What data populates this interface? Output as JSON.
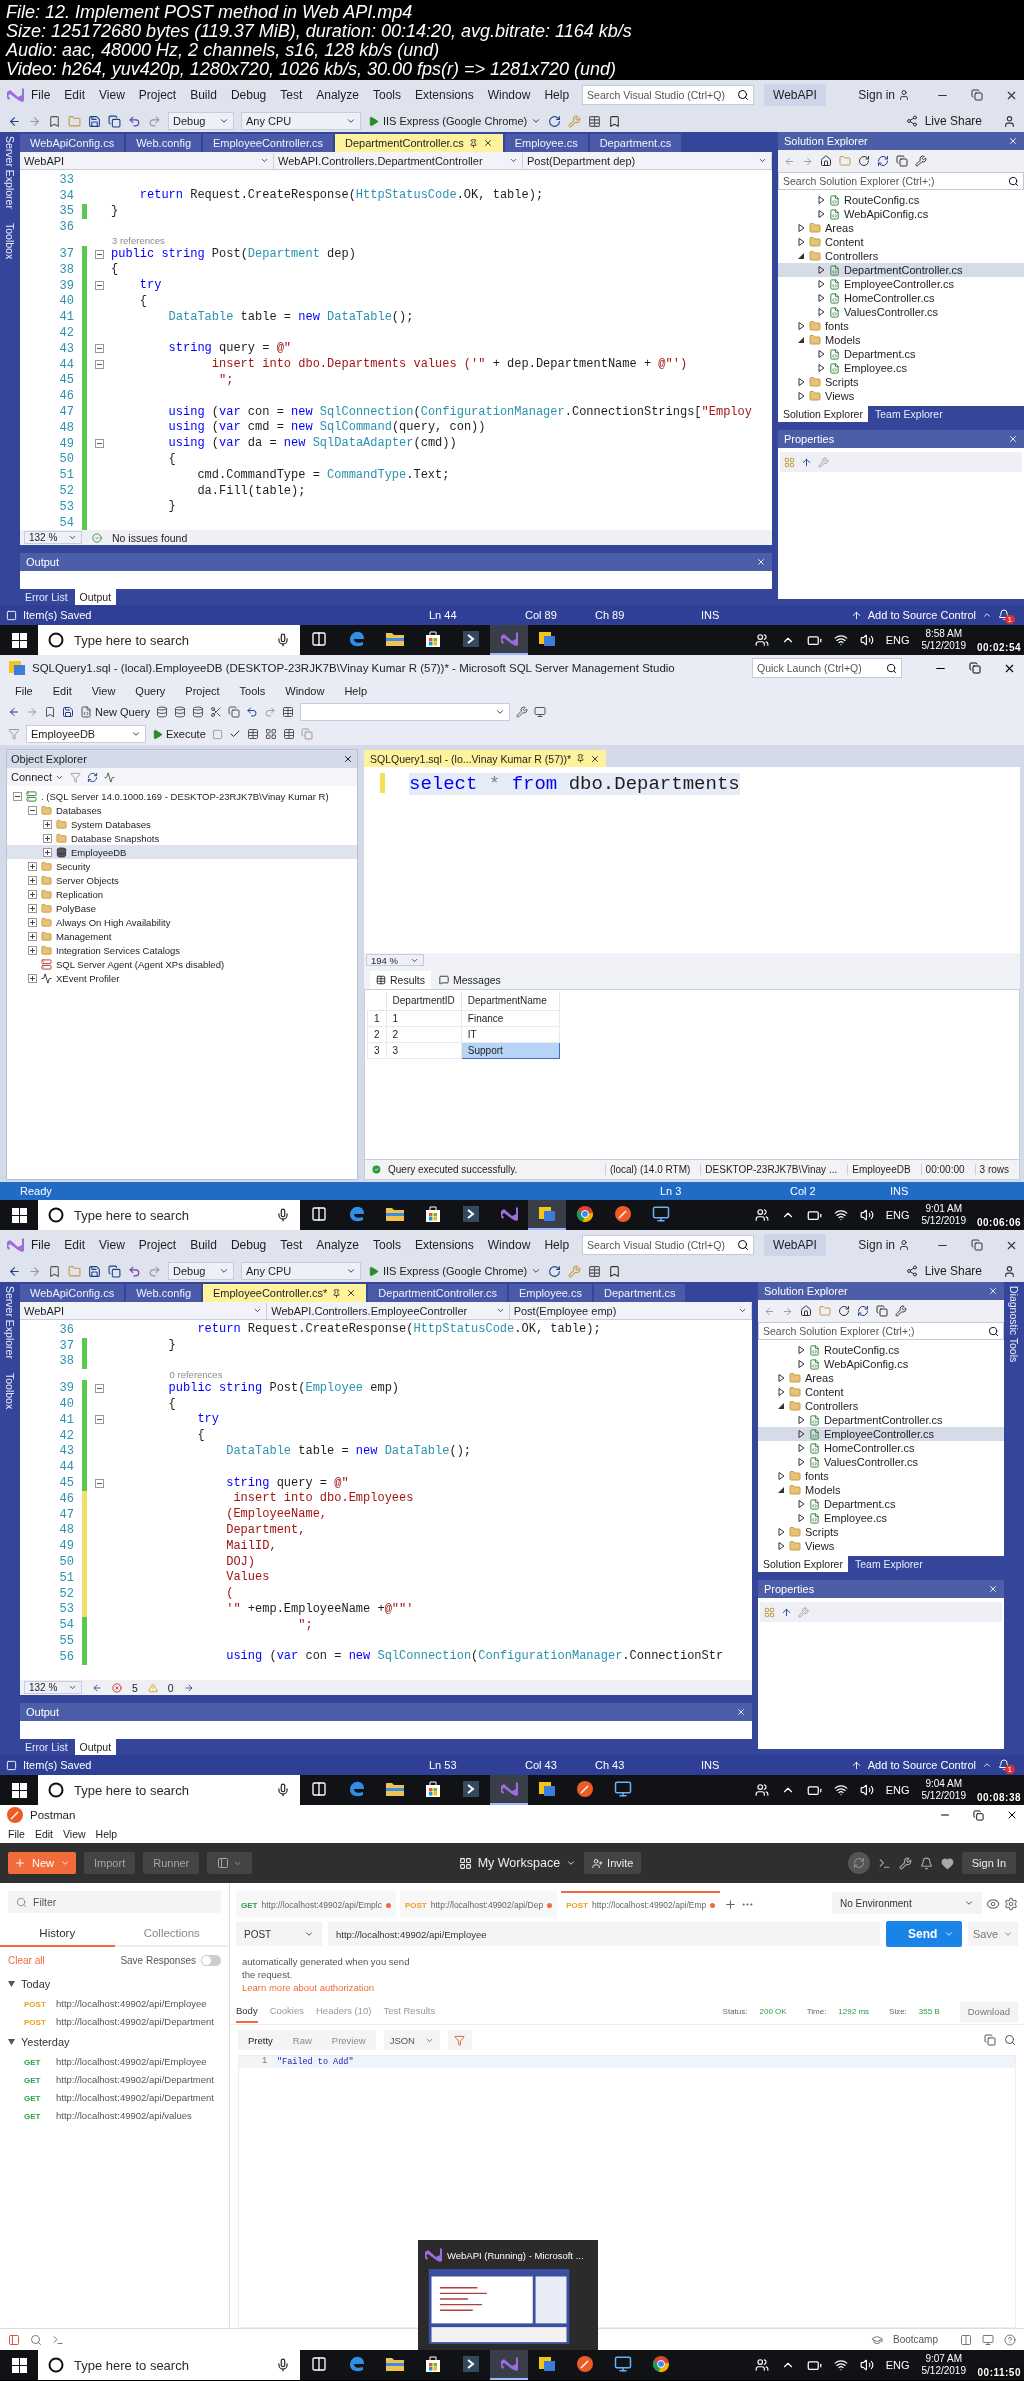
{
  "header": {
    "lines": [
      "File: 12. Implement POST method in Web API.mp4",
      "Size: 125172680 bytes (119.37 MiB), duration: 00:14:20, avg.bitrate: 1164 kb/s",
      "Audio: aac, 48000 Hz, 2 channels, s16, 128 kb/s (und)",
      "Video: h264, yuv420p, 1280x720, 1026 kb/s, 30.00 fps(r) => 1281x720 (und)"
    ]
  },
  "frames": [
    {
      "kind": "vs",
      "menu": [
        "File",
        "Edit",
        "View",
        "Project",
        "Build",
        "Debug",
        "Test",
        "Analyze",
        "Tools",
        "Extensions",
        "Window",
        "Help"
      ],
      "search": {
        "placeholder": "Search Visual Studio (Ctrl+Q)"
      },
      "solution_name": "WebAPI",
      "sign_in": "Sign in",
      "toolbar": {
        "configuration": "Debug",
        "platform": "Any CPU",
        "run": "IIS Express (Google Chrome)",
        "live_share": "Live Share"
      },
      "left_rail": [
        "Server Explorer",
        "Toolbox"
      ],
      "tabs": [
        {
          "label": "WebApiConfig.cs",
          "selected": false
        },
        {
          "label": "Web.config",
          "selected": false
        },
        {
          "label": "EmployeeController.cs",
          "selected": false
        },
        {
          "label": "DepartmentController.cs",
          "selected": true
        },
        {
          "label": "Employee.cs",
          "selected": false
        },
        {
          "label": "Department.cs",
          "selected": false
        }
      ],
      "nav": [
        "WebAPI",
        "WebAPI.Controllers.DepartmentController",
        "Post(Department dep)"
      ],
      "lines": [
        {
          "kind": "code",
          "n": "33"
        },
        {
          "kind": "code",
          "n": "34",
          "code": [
            {
              "kind": "kw",
              "text": "    return"
            },
            {
              "kind": "plain",
              "text": " Request.CreateResponse("
            },
            {
              "kind": "type",
              "text": "HttpStatusCode"
            },
            {
              "kind": "plain",
              "text": ".OK, table);"
            }
          ]
        },
        {
          "kind": "code",
          "n": "35",
          "color": "#5ac84e",
          "code": [
            {
              "kind": "plain",
              "text": "}"
            }
          ]
        },
        {
          "kind": "code",
          "n": "36"
        },
        {
          "kind": "lens",
          "text": "3 references"
        },
        {
          "kind": "code",
          "n": "37",
          "color": "#5ac84e",
          "fold": true,
          "code": [
            {
              "kind": "kw",
              "text": "public string"
            },
            {
              "kind": "plain",
              "text": " Post("
            },
            {
              "kind": "type",
              "text": "Department"
            },
            {
              "kind": "plain",
              "text": " dep)"
            }
          ]
        },
        {
          "kind": "code",
          "n": "38",
          "color": "#5ac84e",
          "code": [
            {
              "kind": "plain",
              "text": "{"
            }
          ]
        },
        {
          "kind": "code",
          "n": "39",
          "color": "#5ac84e",
          "fold": true,
          "code": [
            {
              "kind": "kw",
              "text": "    try"
            }
          ]
        },
        {
          "kind": "code",
          "n": "40",
          "color": "#5ac84e",
          "code": [
            {
              "kind": "plain",
              "text": "    {"
            }
          ]
        },
        {
          "kind": "code",
          "n": "41",
          "color": "#5ac84e",
          "code": [
            {
              "kind": "type",
              "text": "        DataTable"
            },
            {
              "kind": "plain",
              "text": " table = "
            },
            {
              "kind": "kw",
              "text": "new"
            },
            {
              "kind": "type",
              "text": " DataTable"
            },
            {
              "kind": "plain",
              "text": "();"
            }
          ]
        },
        {
          "kind": "code",
          "n": "42",
          "color": "#5ac84e"
        },
        {
          "kind": "code",
          "n": "43",
          "color": "#5ac84e",
          "fold": true,
          "code": [
            {
              "kind": "kw",
              "text": "        string"
            },
            {
              "kind": "plain",
              "text": " query = "
            },
            {
              "kind": "str",
              "text": "@\""
            }
          ]
        },
        {
          "kind": "code",
          "n": "44",
          "color": "#5ac84e",
          "fold": true,
          "code": [
            {
              "kind": "str",
              "text": "              insert into dbo.Departments values ('\""
            },
            {
              "kind": "plain",
              "text": " + dep.DepartmentName + "
            },
            {
              "kind": "str",
              "text": "@\"')"
            }
          ]
        },
        {
          "kind": "code",
          "n": "45",
          "color": "#5ac84e",
          "code": [
            {
              "kind": "str",
              "text": "               \";"
            }
          ]
        },
        {
          "kind": "code",
          "n": "46",
          "color": "#5ac84e"
        },
        {
          "kind": "code",
          "n": "47",
          "color": "#5ac84e",
          "code": [
            {
              "kind": "kw",
              "text": "        using"
            },
            {
              "kind": "plain",
              "text": " ("
            },
            {
              "kind": "kw",
              "text": "var"
            },
            {
              "kind": "plain",
              "text": " con = "
            },
            {
              "kind": "kw",
              "text": "new"
            },
            {
              "kind": "type",
              "text": " SqlConnection"
            },
            {
              "kind": "plain",
              "text": "("
            },
            {
              "kind": "type",
              "text": "ConfigurationManager"
            },
            {
              "kind": "plain",
              "text": ".ConnectionStrings["
            },
            {
              "kind": "str",
              "text": "\"Employ"
            }
          ]
        },
        {
          "kind": "code",
          "n": "48",
          "color": "#5ac84e",
          "code": [
            {
              "kind": "kw",
              "text": "        using"
            },
            {
              "kind": "plain",
              "text": " ("
            },
            {
              "kind": "kw",
              "text": "var"
            },
            {
              "kind": "plain",
              "text": " cmd = "
            },
            {
              "kind": "kw",
              "text": "new"
            },
            {
              "kind": "type",
              "text": " SqlCommand"
            },
            {
              "kind": "plain",
              "text": "(query, con))"
            }
          ]
        },
        {
          "kind": "code",
          "n": "49",
          "color": "#5ac84e",
          "fold": true,
          "code": [
            {
              "kind": "kw",
              "text": "        using"
            },
            {
              "kind": "plain",
              "text": " ("
            },
            {
              "kind": "kw",
              "text": "var"
            },
            {
              "kind": "plain",
              "text": " da = "
            },
            {
              "kind": "kw",
              "text": "new"
            },
            {
              "kind": "type",
              "text": " SqlDataAdapter"
            },
            {
              "kind": "plain",
              "text": "(cmd))"
            }
          ]
        },
        {
          "kind": "code",
          "n": "50",
          "color": "#5ac84e",
          "code": [
            {
              "kind": "plain",
              "text": "        {"
            }
          ]
        },
        {
          "kind": "code",
          "n": "51",
          "color": "#5ac84e",
          "code": [
            {
              "kind": "plain",
              "text": "            cmd.CommandType = "
            },
            {
              "kind": "type",
              "text": "CommandType"
            },
            {
              "kind": "plain",
              "text": ".Text;"
            }
          ]
        },
        {
          "kind": "code",
          "n": "52",
          "color": "#5ac84e",
          "code": [
            {
              "kind": "plain",
              "text": "            da.Fill(table);"
            }
          ]
        },
        {
          "kind": "code",
          "n": "53",
          "color": "#5ac84e",
          "code": [
            {
              "kind": "plain",
              "text": "        }"
            }
          ]
        },
        {
          "kind": "code",
          "n": "54",
          "color": "#5ac84e"
        }
      ],
      "editor_status": {
        "zoom": "132 %",
        "issues": "No issues found"
      },
      "output": {
        "title": "Output",
        "tabs": [
          {
            "label": "Error List",
            "selected": false
          },
          {
            "label": "Output",
            "selected": true
          }
        ]
      },
      "solution_explorer": {
        "title": "Solution Explorer",
        "search": {
          "placeholder": "Search Solution Explorer (Ctrl+;)"
        },
        "tree": [
          {
            "children": [
              {
                "label": "RouteConfig.cs",
                "kind": "file",
                "expanded": false,
                "selected": false
              },
              {
                "label": "WebApiConfig.cs",
                "kind": "file",
                "expanded": false,
                "selected": false
              }
            ]
          },
          {
            "label": "Areas",
            "kind": "folder",
            "expanded": false,
            "selected": false
          },
          {
            "label": "Content",
            "kind": "folder",
            "expanded": false,
            "selected": false
          },
          {
            "label": "Controllers",
            "kind": "folder",
            "expanded": true,
            "selected": false,
            "children": [
              {
                "label": "DepartmentController.cs",
                "kind": "file",
                "expanded": false,
                "selected": true
              },
              {
                "label": "EmployeeController.cs",
                "kind": "file",
                "expanded": false,
                "selected": false
              },
              {
                "label": "HomeController.cs",
                "kind": "file",
                "expanded": false,
                "selected": false
              },
              {
                "label": "ValuesController.cs",
                "kind": "file",
                "expanded": false,
                "selected": false
              }
            ]
          },
          {
            "label": "fonts",
            "kind": "folder",
            "expanded": false,
            "selected": false
          },
          {
            "label": "Models",
            "kind": "folder",
            "expanded": true,
            "selected": false,
            "children": [
              {
                "label": "Department.cs",
                "kind": "file",
                "expanded": false,
                "selected": false
              },
              {
                "label": "Employee.cs",
                "kind": "file",
                "expanded": false,
                "selected": false
              }
            ]
          },
          {
            "label": "Scripts",
            "kind": "folder",
            "expanded": false,
            "selected": false
          },
          {
            "label": "Views",
            "kind": "folder",
            "expanded": false,
            "selected": false
          }
        ],
        "tabs": [
          {
            "label": "Solution Explorer",
            "selected": true
          },
          {
            "label": "Team Explorer",
            "selected": false
          }
        ]
      },
      "properties": {
        "title": "Properties"
      },
      "status_bar": {
        "message": "Item(s) Saved",
        "ln": "Ln 44",
        "col": "Col 89",
        "ch": "Ch 89",
        "mode": "INS",
        "source_control": "Add to Source Control",
        "notifications": "1"
      },
      "taskbar": {
        "search": {
          "placeholder": "Type here to search"
        },
        "apps": [
          {
            "kind": "edge",
            "active": false
          },
          {
            "kind": "explorer",
            "active": false
          },
          {
            "kind": "store",
            "active": false
          },
          {
            "kind": "terminal",
            "active": false
          },
          {
            "kind": "vs",
            "active": true
          },
          {
            "kind": "ssms",
            "active": false
          }
        ],
        "language": "ENG",
        "time": "8:58 AM",
        "date": "5/12/2019"
      },
      "timestamp": "00:02:54"
    },
    {
      "kind": "ssms",
      "title": "SQLQuery1.sql - (local).EmployeeDB (DESKTOP-23RJK7B\\Vinay Kumar R (57))* - Microsoft SQL Server Management Studio",
      "quick_launch": {
        "placeholder": "Quick Launch (Ctrl+Q)"
      },
      "menu": [
        "File",
        "Edit",
        "View",
        "Query",
        "Project",
        "Tools",
        "Window",
        "Help"
      ],
      "toolbar": {
        "new_query": "New Query",
        "database": "EmployeeDB",
        "execute": "Execute"
      },
      "object_explorer": {
        "title": "Object Explorer",
        "connect": "Connect",
        "tree": [
          {
            "label": ". (SQL Server 14.0.1000.169 - DESKTOP-23RJK7B\\Vinay Kumar R)",
            "kind": "server",
            "expanded": true,
            "selected": false,
            "children": [
              {
                "label": "Databases",
                "kind": "folder",
                "expanded": true,
                "selected": false,
                "children": [
                  {
                    "label": "System Databases",
                    "kind": "folder",
                    "expanded": false,
                    "selected": false
                  },
                  {
                    "label": "Database Snapshots",
                    "kind": "folder",
                    "expanded": false,
                    "selected": false
                  },
                  {
                    "label": "EmployeeDB",
                    "kind": "database",
                    "expanded": false,
                    "selected": true
                  }
                ]
              },
              {
                "label": "Security",
                "kind": "folder",
                "expanded": false,
                "selected": false
              },
              {
                "label": "Server Objects",
                "kind": "folder",
                "expanded": false,
                "selected": false
              },
              {
                "label": "Replication",
                "kind": "folder",
                "expanded": false,
                "selected": false
              },
              {
                "label": "PolyBase",
                "kind": "folder",
                "expanded": false,
                "selected": false
              },
              {
                "label": "Always On High Availability",
                "kind": "folder",
                "expanded": false,
                "selected": false
              },
              {
                "label": "Management",
                "kind": "folder",
                "expanded": false,
                "selected": false
              },
              {
                "label": "Integration Services Catalogs",
                "kind": "folder",
                "expanded": false,
                "selected": false
              },
              {
                "label": "SQL Server Agent (Agent XPs disabled)",
                "kind": "agent",
                "selected": false
              },
              {
                "label": "XEvent Profiler",
                "kind": "xevent",
                "expanded": false,
                "selected": false
              }
            ]
          }
        ]
      },
      "query_tab": "SQLQuery1.sql - (lo...Vinay Kumar R (57))*",
      "query": [
        {
          "kind": "kw",
          "text": "select"
        },
        {
          "kind": "op",
          "text": " * "
        },
        {
          "kind": "kw",
          "text": "from"
        },
        {
          "kind": "plain",
          "text": " dbo.Departments"
        }
      ],
      "zoom": "194 %",
      "result_tabs": [
        {
          "label": "Results",
          "selected": true
        },
        {
          "label": "Messages",
          "selected": false
        }
      ],
      "grid": {
        "columns": [
          "DepartmentID",
          "DepartmentName"
        ],
        "rows": [
          {
            "n": "1",
            "cells": [
              {
                "text": "1",
                "selected": false
              },
              {
                "text": "Finance",
                "selected": false
              }
            ]
          },
          {
            "n": "2",
            "cells": [
              {
                "text": "2",
                "selected": false
              },
              {
                "text": "IT",
                "selected": false
              }
            ]
          },
          {
            "n": "3",
            "cells": [
              {
                "text": "3",
                "selected": false
              },
              {
                "text": "Support",
                "selected": true
              }
            ]
          }
        ]
      },
      "query_status": {
        "message": "Query executed successfully.",
        "server": "(local) (14.0 RTM)",
        "user": "DESKTOP-23RJK7B\\Vinay ...",
        "database": "EmployeeDB",
        "elapsed": "00:00:00",
        "rows": "3 rows"
      },
      "status_bar": {
        "message": "Ready",
        "ln": "Ln 3",
        "col": "Col 2",
        "mode": "INS"
      },
      "taskbar": {
        "search": {
          "placeholder": "Type here to search"
        },
        "apps": [
          {
            "kind": "edge",
            "active": false
          },
          {
            "kind": "explorer",
            "active": false
          },
          {
            "kind": "store",
            "active": false
          },
          {
            "kind": "terminal",
            "active": false
          },
          {
            "kind": "vs",
            "active": false
          },
          {
            "kind": "ssms",
            "active": true
          },
          {
            "kind": "chrome",
            "active": false
          },
          {
            "kind": "postman",
            "active": false
          },
          {
            "kind": "rdp",
            "active": false
          }
        ],
        "language": "ENG",
        "time": "9:01 AM",
        "date": "5/12/2019"
      },
      "timestamp": "00:06:06"
    },
    {
      "kind": "vs",
      "menu": [
        "File",
        "Edit",
        "View",
        "Project",
        "Build",
        "Debug",
        "Test",
        "Analyze",
        "Tools",
        "Extensions",
        "Window",
        "Help"
      ],
      "search": {
        "placeholder": "Search Visual Studio (Ctrl+Q)"
      },
      "solution_name": "WebAPI",
      "sign_in": "Sign in",
      "toolbar": {
        "configuration": "Debug",
        "platform": "Any CPU",
        "run": "IIS Express (Google Chrome)",
        "live_share": "Live Share"
      },
      "left_rail": [
        "Server Explorer",
        "Toolbox"
      ],
      "right_rail": [
        "Diagnostic Tools"
      ],
      "tabs": [
        {
          "label": "WebApiConfig.cs",
          "selected": false
        },
        {
          "label": "Web.config",
          "selected": false
        },
        {
          "label": "EmployeeController.cs*",
          "selected": true
        },
        {
          "label": "DepartmentController.cs",
          "selected": false
        },
        {
          "label": "Employee.cs",
          "selected": false
        },
        {
          "label": "Department.cs",
          "selected": false
        }
      ],
      "nav": [
        "WebAPI",
        "WebAPI.Controllers.EmployeeController",
        "Post(Employee emp)"
      ],
      "lines": [
        {
          "kind": "code",
          "n": "36",
          "code": [
            {
              "kind": "kw",
              "text": "            return"
            },
            {
              "kind": "plain",
              "text": " Request.CreateResponse("
            },
            {
              "kind": "type",
              "text": "HttpStatusCode"
            },
            {
              "kind": "plain",
              "text": ".OK, table);"
            }
          ]
        },
        {
          "kind": "code",
          "n": "37",
          "color": "#5ac84e",
          "code": [
            {
              "kind": "plain",
              "text": "        }"
            }
          ]
        },
        {
          "kind": "code",
          "n": "38",
          "color": "#5ac84e"
        },
        {
          "kind": "lens",
          "text": "0 references"
        },
        {
          "kind": "code",
          "n": "39",
          "color": "#5ac84e",
          "fold": true,
          "code": [
            {
              "kind": "kw",
              "text": "        public string"
            },
            {
              "kind": "plain",
              "text": " Post("
            },
            {
              "kind": "type",
              "text": "Employee"
            },
            {
              "kind": "plain",
              "text": " emp)"
            }
          ]
        },
        {
          "kind": "code",
          "n": "40",
          "color": "#5ac84e",
          "code": [
            {
              "kind": "plain",
              "text": "        {"
            }
          ]
        },
        {
          "kind": "code",
          "n": "41",
          "color": "#5ac84e",
          "fold": true,
          "code": [
            {
              "kind": "kw",
              "text": "            try"
            }
          ]
        },
        {
          "kind": "code",
          "n": "42",
          "color": "#5ac84e",
          "code": [
            {
              "kind": "plain",
              "text": "            {"
            }
          ]
        },
        {
          "kind": "code",
          "n": "43",
          "color": "#5ac84e",
          "code": [
            {
              "kind": "type",
              "text": "                DataTable"
            },
            {
              "kind": "plain",
              "text": " table = "
            },
            {
              "kind": "kw",
              "text": "new"
            },
            {
              "kind": "type",
              "text": " DataTable"
            },
            {
              "kind": "plain",
              "text": "();"
            }
          ]
        },
        {
          "kind": "code",
          "n": "44",
          "color": "#5ac84e"
        },
        {
          "kind": "code",
          "n": "45",
          "color": "#5ac84e",
          "fold": true,
          "code": [
            {
              "kind": "kw",
              "text": "                string"
            },
            {
              "kind": "plain",
              "text": " query = "
            },
            {
              "kind": "str",
              "text": "@\""
            }
          ]
        },
        {
          "kind": "code",
          "n": "46",
          "color": "#eedf6a",
          "code": [
            {
              "kind": "str",
              "text": "                 insert into dbo.Employees"
            }
          ]
        },
        {
          "kind": "code",
          "n": "47",
          "color": "#eedf6a",
          "code": [
            {
              "kind": "str",
              "text": "                (EmployeeName,"
            }
          ]
        },
        {
          "kind": "code",
          "n": "48",
          "color": "#eedf6a",
          "code": [
            {
              "kind": "str",
              "text": "                Department,"
            }
          ]
        },
        {
          "kind": "code",
          "n": "49",
          "color": "#eedf6a",
          "code": [
            {
              "kind": "str",
              "text": "                MailID,"
            }
          ]
        },
        {
          "kind": "code",
          "n": "50",
          "color": "#eedf6a",
          "code": [
            {
              "kind": "str",
              "text": "                DOJ)"
            }
          ]
        },
        {
          "kind": "code",
          "n": "51",
          "color": "#eedf6a",
          "code": [
            {
              "kind": "str",
              "text": "                Values"
            }
          ]
        },
        {
          "kind": "code",
          "n": "52",
          "color": "#eedf6a",
          "code": [
            {
              "kind": "str",
              "text": "                ("
            }
          ]
        },
        {
          "kind": "code",
          "n": "53",
          "color": "#eedf6a",
          "code": [
            {
              "kind": "str",
              "text": "                '\""
            },
            {
              "kind": "plain",
              "text": " +emp.EmployeeName +"
            },
            {
              "kind": "str",
              "text": "@\"\"'"
            }
          ]
        },
        {
          "kind": "code",
          "n": "54",
          "color": "#5ac84e",
          "code": [
            {
              "kind": "str",
              "text": "                          \";"
            }
          ]
        },
        {
          "kind": "code",
          "n": "55",
          "color": "#5ac84e"
        },
        {
          "kind": "code",
          "n": "56",
          "color": "#5ac84e",
          "code": [
            {
              "kind": "kw",
              "text": "                using"
            },
            {
              "kind": "plain",
              "text": " ("
            },
            {
              "kind": "kw",
              "text": "var"
            },
            {
              "kind": "plain",
              "text": " con = "
            },
            {
              "kind": "kw",
              "text": "new"
            },
            {
              "kind": "type",
              "text": " SqlConnection"
            },
            {
              "kind": "plain",
              "text": "("
            },
            {
              "kind": "type",
              "text": "ConfigurationManager"
            },
            {
              "kind": "plain",
              "text": ".ConnectionStr"
            }
          ]
        }
      ],
      "editor_status": {
        "zoom": "132 %",
        "errors": "5",
        "warnings": "0"
      },
      "output": {
        "title": "Output",
        "tabs": [
          {
            "label": "Error List",
            "selected": false
          },
          {
            "label": "Output",
            "selected": true
          }
        ]
      },
      "solution_explorer": {
        "title": "Solution Explorer",
        "search": {
          "placeholder": "Search Solution Explorer (Ctrl+;)"
        },
        "tree": [
          {
            "children": [
              {
                "label": "RouteConfig.cs",
                "kind": "file",
                "expanded": false,
                "selected": false
              },
              {
                "label": "WebApiConfig.cs",
                "kind": "file",
                "expanded": false,
                "selected": false
              }
            ]
          },
          {
            "label": "Areas",
            "kind": "folder",
            "expanded": false,
            "selected": false
          },
          {
            "label": "Content",
            "kind": "folder",
            "expanded": false,
            "selected": false
          },
          {
            "label": "Controllers",
            "kind": "folder",
            "expanded": true,
            "selected": false,
            "children": [
              {
                "label": "DepartmentController.cs",
                "kind": "file",
                "expanded": false,
                "selected": false
              },
              {
                "label": "EmployeeController.cs",
                "kind": "file",
                "expanded": false,
                "selected": true
              },
              {
                "label": "HomeController.cs",
                "kind": "file",
                "expanded": false,
                "selected": false
              },
              {
                "label": "ValuesController.cs",
                "kind": "file",
                "expanded": false,
                "selected": false
              }
            ]
          },
          {
            "label": "fonts",
            "kind": "folder",
            "expanded": false,
            "selected": false
          },
          {
            "label": "Models",
            "kind": "folder",
            "expanded": true,
            "selected": false,
            "children": [
              {
                "label": "Department.cs",
                "kind": "file",
                "expanded": false,
                "selected": false
              },
              {
                "label": "Employee.cs",
                "kind": "file",
                "expanded": false,
                "selected": false
              }
            ]
          },
          {
            "label": "Scripts",
            "kind": "folder",
            "expanded": false,
            "selected": false
          },
          {
            "label": "Views",
            "kind": "folder",
            "expanded": false,
            "selected": false
          }
        ],
        "tabs": [
          {
            "label": "Solution Explorer",
            "selected": true
          },
          {
            "label": "Team Explorer",
            "selected": false
          }
        ]
      },
      "properties": {
        "title": "Properties"
      },
      "status_bar": {
        "message": "Item(s) Saved",
        "ln": "Ln 53",
        "col": "Col 43",
        "ch": "Ch 43",
        "mode": "INS",
        "source_control": "Add to Source Control",
        "notifications": "1"
      },
      "taskbar": {
        "search": {
          "placeholder": "Type here to search"
        },
        "apps": [
          {
            "kind": "edge",
            "active": false
          },
          {
            "kind": "explorer",
            "active": false
          },
          {
            "kind": "store",
            "active": false
          },
          {
            "kind": "terminal",
            "active": false
          },
          {
            "kind": "vs",
            "active": true
          },
          {
            "kind": "ssms",
            "active": false
          },
          {
            "kind": "postman",
            "active": false
          },
          {
            "kind": "rdp",
            "active": false
          }
        ],
        "language": "ENG",
        "time": "9:04 AM",
        "date": "5/12/2019"
      },
      "timestamp": "00:08:38"
    },
    {
      "kind": "postman",
      "title": "Postman",
      "menu": [
        "File",
        "Edit",
        "View",
        "Help"
      ],
      "header": {
        "new": "New",
        "import": "Import",
        "runner": "Runner",
        "workspace": "My Workspace",
        "invite": "Invite",
        "sign_in": "Sign In"
      },
      "sidebar": {
        "filter": {
          "placeholder": "Filter"
        },
        "tabs": [
          {
            "label": "History",
            "selected": true
          },
          {
            "label": "Collections",
            "selected": false
          }
        ],
        "clear": "Clear all",
        "save_responses": {
          "label": "Save Responses",
          "on": false
        },
        "groups": [
          {
            "label": "Today",
            "expanded": true,
            "items": [
              {
                "method": "POST",
                "color": "#e8a31c",
                "url": "http://localhost:49902/api/Employee"
              },
              {
                "method": "POST",
                "color": "#e8a31c",
                "url": "http://localhost:49902/api/Department"
              }
            ]
          },
          {
            "label": "Yesterday",
            "expanded": true,
            "items": [
              {
                "method": "GET",
                "color": "#2ba14b",
                "url": "http://localhost:49902/api/Employee"
              },
              {
                "method": "GET",
                "color": "#2ba14b",
                "url": "http://localhost:49902/api/Department"
              },
              {
                "method": "GET",
                "color": "#2ba14b",
                "url": "http://localhost:49902/api/Department"
              },
              {
                "method": "GET",
                "color": "#2ba14b",
                "url": "http://localhost:49902/api/values"
              }
            ]
          }
        ]
      },
      "request_tabs": [
        {
          "method": "GET",
          "color": "#2ba14b",
          "url": "http://localhost:49902/api/Emplc",
          "selected": false
        },
        {
          "method": "POST",
          "color": "#e8a31c",
          "url": "http://localhost:49902/api/Dep",
          "selected": false
        },
        {
          "method": "POST",
          "color": "#e8a31c",
          "url": "http://localhost:49902/api/Emp",
          "selected": true
        }
      ],
      "environment": "No Environment",
      "request": {
        "method": "POST",
        "url": "http://localhost:49902/api/Employee",
        "send": "Send",
        "save": "Save"
      },
      "auth_note": {
        "text": "automatically generated when you send the request.",
        "link": "Learn more about authorization"
      },
      "response": {
        "tabs": [
          {
            "label": "Body",
            "selected": true
          },
          {
            "label": "Cookies",
            "selected": false
          },
          {
            "label": "Headers (10)",
            "selected": false
          },
          {
            "label": "Test Results",
            "selected": false
          }
        ],
        "status_label": "Status:",
        "status": "200 OK",
        "time_label": "Time:",
        "time": "1292 ms",
        "size_label": "Size:",
        "size": "355 B",
        "download": "Download",
        "views": [
          {
            "label": "Pretty",
            "selected": true
          },
          {
            "label": "Raw",
            "selected": false
          },
          {
            "label": "Preview",
            "selected": false
          }
        ],
        "format": "JSON",
        "lines": [
          {
            "n": "1",
            "text": "\"Failed to Add\""
          }
        ]
      },
      "footer": {
        "bootcamp": "Bootcamp"
      },
      "taskbar": {
        "search": {
          "placeholder": "Type here to search"
        },
        "apps": [
          {
            "kind": "edge",
            "active": false
          },
          {
            "kind": "explorer",
            "active": false
          },
          {
            "kind": "store",
            "active": false
          },
          {
            "kind": "terminal",
            "active": false
          },
          {
            "kind": "vs",
            "active": true
          },
          {
            "kind": "ssms",
            "active": false
          },
          {
            "kind": "postman",
            "active": false
          },
          {
            "kind": "rdp",
            "active": false
          },
          {
            "kind": "chrome",
            "active": false
          }
        ],
        "language": "ENG",
        "time": "9:07 AM",
        "date": "5/12/2019",
        "preview": {
          "title": "WebAPI (Running) - Microsoft ..."
        }
      },
      "timestamp": "00:11:50"
    }
  ]
}
